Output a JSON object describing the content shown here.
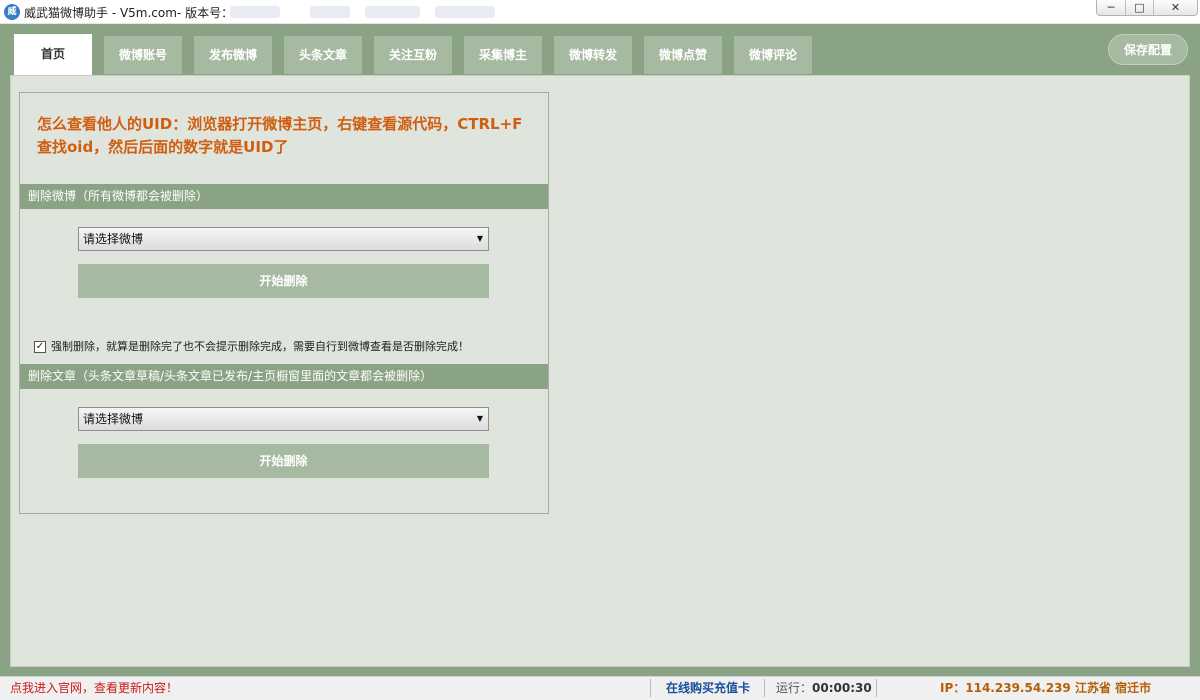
{
  "window": {
    "app_icon_text": "威",
    "title": "威武猫微博助手 - V5m.com- 版本号：V2.5",
    "buttons": {
      "minimize": "─",
      "maximize": "□",
      "close": "✕"
    }
  },
  "tabs": [
    {
      "label": "首页",
      "active": true
    },
    {
      "label": "微博账号",
      "active": false
    },
    {
      "label": "发布微博",
      "active": false
    },
    {
      "label": "头条文章",
      "active": false
    },
    {
      "label": "关注互粉",
      "active": false
    },
    {
      "label": "采集博主",
      "active": false
    },
    {
      "label": "微博转发",
      "active": false
    },
    {
      "label": "微博点赞",
      "active": false
    },
    {
      "label": "微博评论",
      "active": false
    }
  ],
  "save_config_label": "保存配置",
  "help": {
    "uid_text": "怎么查看他人的UID：浏览器打开微博主页，右键查看源代码，CTRL+F查找oid，然后后面的数字就是UID了"
  },
  "delete_weibo": {
    "header": "删除微博（所有微博都会被删除）",
    "select_value": "请选择微博",
    "start_label": "开始删除"
  },
  "force_delete": {
    "checked": true,
    "check_mark": "✓",
    "label": "强制删除，就算是删除完了也不会提示删除完成，需要自行到微博查看是否删除完成！"
  },
  "delete_article": {
    "header": "删除文章（头条文章草稿/头条文章已发布/主页橱窗里面的文章都会被删除）",
    "select_value": "请选择微博",
    "start_label": "开始删除"
  },
  "caret": "▼",
  "status": {
    "website_link": "点我进入官网，查看更新内容！",
    "buy_card": "在线购买充值卡",
    "runtime_label": "运行：",
    "runtime_value": "00:00:30",
    "ip_text": "IP：114.239.54.239  江苏省 宿迁市"
  },
  "colors": {
    "frame_green": "#8aa384",
    "tab_green": "#a6baa1",
    "content_bg": "#dfe4dc",
    "help_orange": "#d05e10",
    "status_red": "#cc1a1a",
    "status_blue": "#1a4f9a",
    "status_orange": "#b36008"
  }
}
